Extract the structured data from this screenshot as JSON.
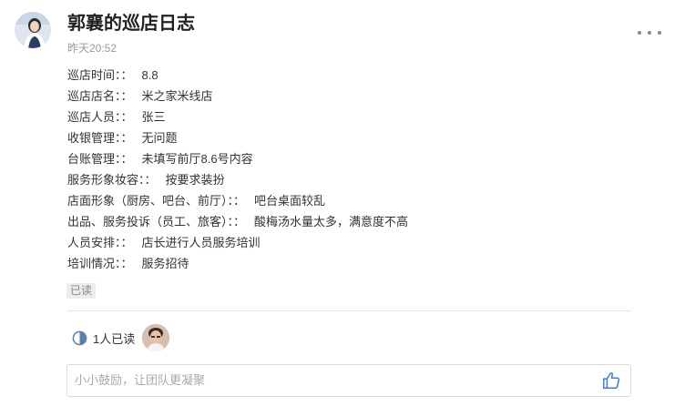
{
  "post": {
    "title": "郭襄的巡店日志",
    "time": "昨天20:52",
    "fields": [
      {
        "label": "巡店时间：：",
        "value": "8.8"
      },
      {
        "label": "巡店店名：：",
        "value": "米之家米线店"
      },
      {
        "label": "巡店人员：：",
        "value": "张三"
      },
      {
        "label": "收银管理：：",
        "value": "无问题"
      },
      {
        "label": "台账管理：：",
        "value": "未填写前厅8.6号内容"
      },
      {
        "label": "服务形象妆容：：",
        "value": "按要求装扮"
      },
      {
        "label": "店面形象（厨房、吧台、前厅）：：",
        "value": "吧台桌面较乱"
      },
      {
        "label": "出品、服务投诉（员工、旅客）：：",
        "value": "酸梅汤水量太多，满意度不高"
      },
      {
        "label": "人员安排：：",
        "value": "店长进行人员服务培训"
      },
      {
        "label": "培训情况：：",
        "value": "服务招待"
      }
    ],
    "read_tag": "已读"
  },
  "readers": {
    "count_label": "1人已读"
  },
  "comment": {
    "placeholder": "小小鼓励，让团队更凝聚",
    "value": ""
  },
  "icons": {
    "more": "more-dots-icon",
    "read_status": "half-circle-icon",
    "like": "thumbs-up-icon"
  },
  "colors": {
    "like_blue": "#3d7be0",
    "read_icon": "#5a7fb0",
    "tag_bg": "#ececec"
  }
}
